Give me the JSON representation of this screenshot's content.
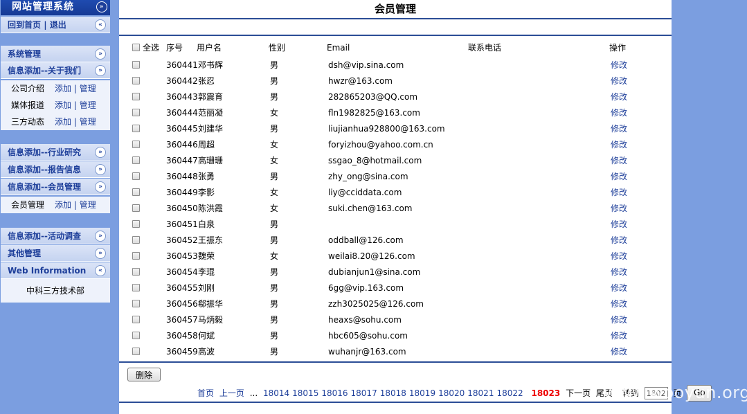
{
  "sidebar": {
    "title": "网站管理系统",
    "home": "回到首页",
    "sep": "|",
    "logout": "退出",
    "sections": [
      {
        "label": "系统管理"
      },
      {
        "label": "信息添加--关于我们"
      },
      {
        "label": "信息添加--行业研究"
      },
      {
        "label": "信息添加--报告信息"
      },
      {
        "label": "信息添加--会员管理"
      },
      {
        "label": "信息添加--活动调查"
      },
      {
        "label": "其他管理"
      },
      {
        "label": "Web Information"
      }
    ],
    "about_items": [
      {
        "name": "公司介绍",
        "add": "添加",
        "manage": "管理"
      },
      {
        "name": "媒体报道",
        "add": "添加",
        "manage": "管理"
      },
      {
        "name": "三方动态",
        "add": "添加",
        "manage": "管理"
      }
    ],
    "member_items": [
      {
        "name": "会员管理",
        "add": "添加",
        "manage": "管理"
      }
    ],
    "web_info": "中科三方技术部",
    "collapse_glyph": "«",
    "expand_glyph": "»"
  },
  "main": {
    "title": "会员管理",
    "headers": {
      "select_all": "全选",
      "id": "序号",
      "username": "用户名",
      "gender": "性别",
      "email": "Email",
      "phone": "联系电话",
      "action": "操作"
    },
    "rows": [
      {
        "id": "360441",
        "name": "邓书辉",
        "gender": "男",
        "email": "dsh@vip.sina.com",
        "phone": "",
        "action": "修改"
      },
      {
        "id": "360442",
        "name": "张忍",
        "gender": "男",
        "email": "hwzr@163.com",
        "phone": "",
        "action": "修改"
      },
      {
        "id": "360443",
        "name": "郭震育",
        "gender": "男",
        "email": "282865203@QQ.com",
        "phone": "",
        "action": "修改"
      },
      {
        "id": "360444",
        "name": "范丽凝",
        "gender": "女",
        "email": "fln1982825@163.com",
        "phone": "",
        "action": "修改"
      },
      {
        "id": "360445",
        "name": "刘建华",
        "gender": "男",
        "email": "liujianhua928800@163.com",
        "phone": "",
        "action": "修改"
      },
      {
        "id": "360446",
        "name": "周超",
        "gender": "女",
        "email": "foryizhou@yahoo.com.cn",
        "phone": "",
        "action": "修改"
      },
      {
        "id": "360447",
        "name": "高珊珊",
        "gender": "女",
        "email": "ssgao_8@hotmail.com",
        "phone": "",
        "action": "修改"
      },
      {
        "id": "360448",
        "name": "张勇",
        "gender": "男",
        "email": "zhy_ong@sina.com",
        "phone": "",
        "action": "修改"
      },
      {
        "id": "360449",
        "name": "李影",
        "gender": "女",
        "email": "liy@cciddata.com",
        "phone": "",
        "action": "修改"
      },
      {
        "id": "360450",
        "name": "陈洪霞",
        "gender": "女",
        "email": "suki.chen@163.com",
        "phone": "",
        "action": "修改"
      },
      {
        "id": "360451",
        "name": "白泉",
        "gender": "男",
        "email": "",
        "phone": "",
        "action": "修改"
      },
      {
        "id": "360452",
        "name": "王振东",
        "gender": "男",
        "email": "oddball@126.com",
        "phone": "",
        "action": "修改"
      },
      {
        "id": "360453",
        "name": "魏荣",
        "gender": "女",
        "email": "weilai8.20@126.com",
        "phone": "",
        "action": "修改"
      },
      {
        "id": "360454",
        "name": "李琨",
        "gender": "男",
        "email": "dubianjun1@sina.com",
        "phone": "",
        "action": "修改"
      },
      {
        "id": "360455",
        "name": "刘刚",
        "gender": "男",
        "email": "6gg@vip.163.com",
        "phone": "",
        "action": "修改"
      },
      {
        "id": "360456",
        "name": "郗振华",
        "gender": "男",
        "email": "zzh3025025@126.com",
        "phone": "",
        "action": "修改"
      },
      {
        "id": "360457",
        "name": "马炳毅",
        "gender": "男",
        "email": "heaxs@sohu.com",
        "phone": "",
        "action": "修改"
      },
      {
        "id": "360458",
        "name": "何斌",
        "gender": "男",
        "email": "hbc605@sohu.com",
        "phone": "",
        "action": "修改"
      },
      {
        "id": "360459",
        "name": "高波",
        "gender": "男",
        "email": "wuhanjr@163.com",
        "phone": "",
        "action": "修改"
      }
    ],
    "delete_button": "删除",
    "pager": {
      "first": "首页",
      "prev": "上一页",
      "ellipsis": "...",
      "pages": [
        "18014",
        "18015",
        "18016",
        "18017",
        "18018",
        "18019",
        "18020",
        "18021",
        "18022"
      ],
      "current": "18023",
      "next": "下一页",
      "last": "尾页",
      "goto_label": "转到",
      "goto_value": "1802",
      "page_unit": "页",
      "go_button": "Go"
    }
  },
  "watermark": "www.wooyun.org",
  "colors": {
    "background": "#7b9ee0",
    "title_bar": "#1f4bb0",
    "link": "#1e3f9a",
    "current_page": "#ee0000",
    "rule": "#2b4d96"
  }
}
